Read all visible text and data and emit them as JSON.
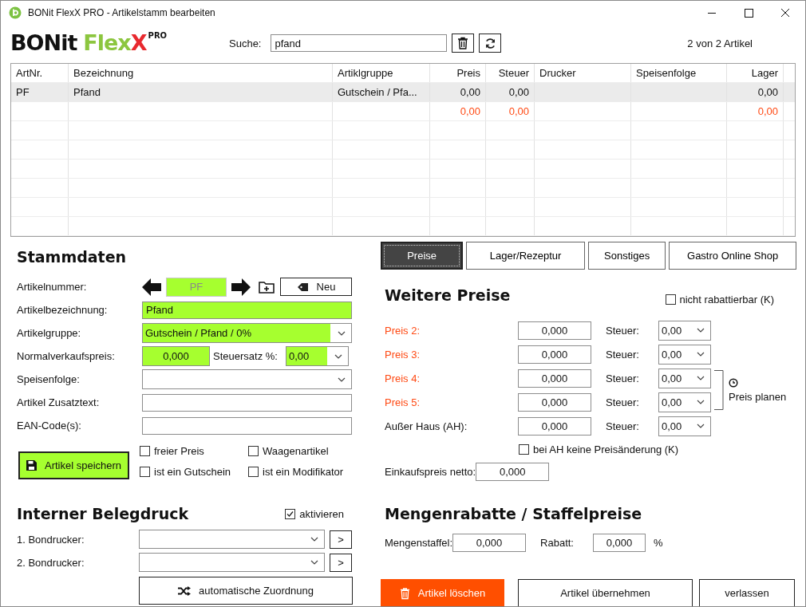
{
  "window": {
    "title": "BONit FlexX PRO - Artikelstamm bearbeiten"
  },
  "logo": {
    "brand": "BONit",
    "product": "Flex",
    "product_end": "X",
    "edition": "PRO"
  },
  "search": {
    "label": "Suche:",
    "value": "pfand"
  },
  "article_count": "2 von 2 Artikel",
  "table": {
    "columns": [
      {
        "label": "ArtNr.",
        "numeric": false
      },
      {
        "label": "Bezeichnung",
        "numeric": false
      },
      {
        "label": "Artiklgruppe",
        "numeric": false
      },
      {
        "label": "Preis",
        "numeric": true
      },
      {
        "label": "Steuer",
        "numeric": true
      },
      {
        "label": "Drucker",
        "numeric": false
      },
      {
        "label": "Speisenfolge",
        "numeric": false
      },
      {
        "label": "Lager",
        "numeric": true
      }
    ],
    "rows": [
      {
        "kind": "article",
        "selected": true,
        "cells": [
          "PF",
          "Pfand",
          "Gutschein / Pfa...",
          "0,00",
          "0,00",
          null,
          null,
          "0,00"
        ]
      },
      {
        "kind": "total",
        "selected": false,
        "cells": [
          null,
          null,
          null,
          "0,00",
          "0,00",
          null,
          null,
          "0,00"
        ]
      }
    ]
  },
  "master_data": {
    "title": "Stammdaten",
    "article_number": {
      "label": "Artikelnummer:",
      "value": "PF",
      "highlighted": true,
      "disabled": true
    },
    "new_button": "Neu",
    "fields": [
      {
        "kind": "text",
        "label": "Artikelbezeichnung:",
        "value": "Pfand",
        "highlighted": true
      },
      {
        "kind": "select",
        "label": "Artikelgruppe:",
        "value": "Gutschein / Pfand / 0%",
        "highlighted": true
      },
      {
        "kind": "price",
        "label": "Normalverkaufspreis:",
        "value": "0,000",
        "highlighted": true,
        "tax_label": "Steuersatz %:",
        "tax_value": "0,00"
      },
      {
        "kind": "select",
        "label": "Speisenfolge:",
        "highlighted": false
      },
      {
        "kind": "text",
        "label": "Artikel Zusatztext:",
        "highlighted": false
      },
      {
        "kind": "text",
        "label": "EAN-Code(s):",
        "highlighted": false
      }
    ],
    "save_button": "Artikel speichern",
    "checkboxes": [
      {
        "label": "freier Preis",
        "checked": false
      },
      {
        "label": "Waagenartikel",
        "checked": false
      },
      {
        "label": "ist ein Gutschein",
        "checked": false
      },
      {
        "label": "ist ein Modifikator",
        "checked": false
      }
    ]
  },
  "receipt_printing": {
    "title": "Interner Belegdruck",
    "activate": {
      "label": "aktivieren",
      "checked": true
    },
    "printers": [
      {
        "label": "1. Bondrucker:",
        "button": ">"
      },
      {
        "label": "2. Bondrucker:",
        "button": ">"
      }
    ],
    "auto_button": "automatische Zuordnung"
  },
  "tabs": [
    {
      "label": "Preise",
      "selected": true
    },
    {
      "label": "Lager/Rezeptur",
      "selected": false
    },
    {
      "label": "Sonstiges",
      "selected": false
    },
    {
      "label": "Gastro Online Shop",
      "selected": false
    }
  ],
  "further_prices": {
    "title": "Weitere Preise",
    "no_discount": {
      "label": "nicht rabattierbar (K)",
      "checked": false
    },
    "rows": [
      {
        "kind": "level",
        "label": "Preis 2:",
        "value": "0,000",
        "tax_label": "Steuer:",
        "tax": "0,00"
      },
      {
        "kind": "level",
        "label": "Preis 3:",
        "value": "0,000",
        "tax_label": "Steuer:",
        "tax": "0,00"
      },
      {
        "kind": "level",
        "label": "Preis 4:",
        "value": "0,000",
        "tax_label": "Steuer:",
        "tax": "0,00"
      },
      {
        "kind": "level",
        "label": "Preis 5:",
        "value": "0,000",
        "tax_label": "Steuer:",
        "tax": "0,00"
      },
      {
        "kind": "takeaway",
        "label": "Außer Haus (AH):",
        "value": "0,000",
        "tax_label": "Steuer:",
        "tax": "0,00"
      }
    ],
    "schedule": "Preis planen",
    "takeaway_fixed": {
      "label": "bei AH keine Preisänderung (K)",
      "checked": false
    },
    "purchase": {
      "label": "Einkaufspreis netto:",
      "value": "0,000"
    }
  },
  "quantity_discount": {
    "title": "Mengenrabatte / Staffelpreise",
    "quantity_label": "Mengenstaffel:",
    "quantity": "0,000",
    "discount_label": "Rabatt:",
    "discount": "0,000",
    "unit": "%"
  },
  "actions": [
    {
      "kind": "delete",
      "label": "Artikel löschen"
    },
    {
      "kind": "normal",
      "label": "Artikel übernehmen"
    },
    {
      "kind": "normal",
      "label": "verlassen"
    }
  ]
}
